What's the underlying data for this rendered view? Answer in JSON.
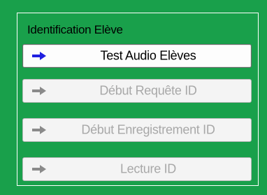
{
  "group": {
    "title": "Identification Elève"
  },
  "buttons": [
    {
      "label": "Test Audio Elèves",
      "icon": "arrow-right-icon",
      "enabled": true,
      "icon_color": "#1f1fe0"
    },
    {
      "label": "Début Requête ID",
      "icon": "arrow-right-icon",
      "enabled": false,
      "icon_color": "#8a8a8a"
    },
    {
      "label": "Début Enregistrement ID",
      "icon": "arrow-right-icon",
      "enabled": false,
      "icon_color": "#8a8a8a"
    },
    {
      "label": "Lecture ID",
      "icon": "arrow-right-icon",
      "enabled": false,
      "icon_color": "#8a8a8a"
    }
  ],
  "colors": {
    "panel_background": "#19a04b",
    "group_border": "#ffffff"
  }
}
